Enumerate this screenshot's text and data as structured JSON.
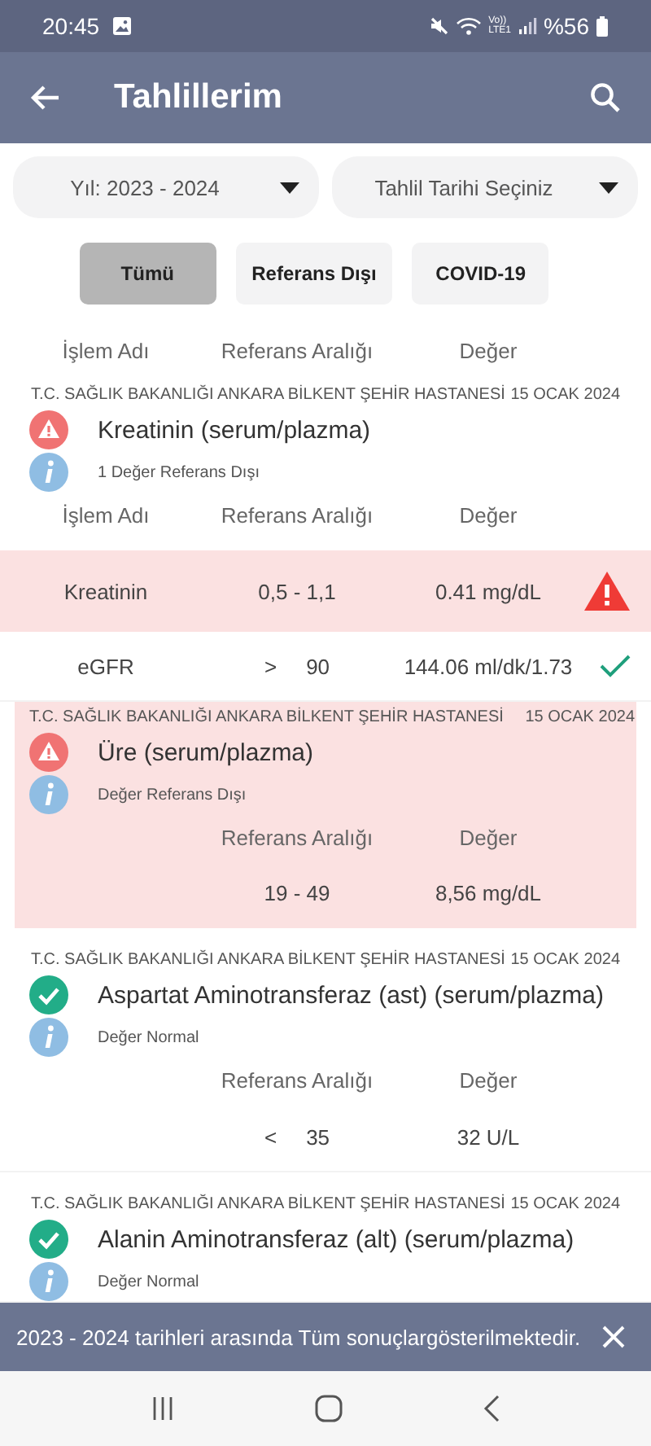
{
  "status_bar": {
    "time": "20:45",
    "volte": "Vo))",
    "network": "LTE1",
    "battery": "%56"
  },
  "app_bar": {
    "title": "Tahlillerim"
  },
  "filters": [
    {
      "value": "Yıl: 2023 - 2024"
    },
    {
      "value": "Tahlil Tarihi Seçiniz"
    }
  ],
  "chips": [
    {
      "label": "Tümü",
      "selected": true
    },
    {
      "label": "Referans Dışı",
      "selected": false
    },
    {
      "label": "COVID-19",
      "selected": false
    }
  ],
  "results": [
    {
      "kind": "partial",
      "columns": [
        "İşlem Adı",
        "Referans Aralığı",
        "Değer"
      ]
    },
    {
      "kind": "card",
      "hospital": "T.C. SAĞLIK BAKANLIĞI ANKARA BİLKENT ŞEHİR HASTANESİ",
      "date": "15 OCAK 2024",
      "out_of_range": true,
      "title": "Kreatinin (serum/plazma)",
      "note": "1 Değer Referans Dışı",
      "highlighted": false,
      "columns": [
        "İşlem Adı",
        "Referans Aralığı",
        "Değer"
      ],
      "rows": [
        {
          "kind": "warning",
          "name": "Kreatinin",
          "range": "0,5 - 1,1",
          "value": "0.41 mg/dL"
        },
        {
          "kind": "check",
          "name": "eGFR",
          "operator": ">",
          "range": "90",
          "value": "144.06 ml/dk/1.73"
        }
      ]
    },
    {
      "kind": "card",
      "hospital": "T.C. SAĞLIK BAKANLIĞI ANKARA BİLKENT ŞEHİR HASTANESİ",
      "date": "15 OCAK 2024",
      "out_of_range": true,
      "title": "Üre (serum/plazma)",
      "note": "Değer Referans Dışı",
      "highlighted": true,
      "columns": [
        "",
        "Referans Aralığı",
        "Değer"
      ],
      "rows": [
        {
          "kind": "plain",
          "range": "19 - 49",
          "value": "8,56 mg/dL"
        }
      ]
    },
    {
      "kind": "card",
      "hospital": "T.C. SAĞLIK BAKANLIĞI ANKARA BİLKENT ŞEHİR HASTANESİ",
      "date": "15 OCAK 2024",
      "out_of_range": false,
      "title": "Aspartat Aminotransferaz (ast) (serum/plazma)",
      "note": "Değer Normal",
      "highlighted": false,
      "columns": [
        "",
        "Referans Aralığı",
        "Değer"
      ],
      "rows": [
        {
          "kind": "plain",
          "operator": "<",
          "range": "35",
          "value": "32 U/L"
        }
      ]
    },
    {
      "kind": "card",
      "hospital": "T.C. SAĞLIK BAKANLIĞI ANKARA BİLKENT ŞEHİR HASTANESİ",
      "date": "15 OCAK 2024",
      "out_of_range": false,
      "title": "Alanin Aminotransferaz (alt) (serum/plazma)",
      "note": "Değer Normal",
      "highlighted": false
    }
  ],
  "snackbar": {
    "message": "2023 - 2024 tarihleri arasında Tüm sonuçlargösterilmektedir."
  }
}
